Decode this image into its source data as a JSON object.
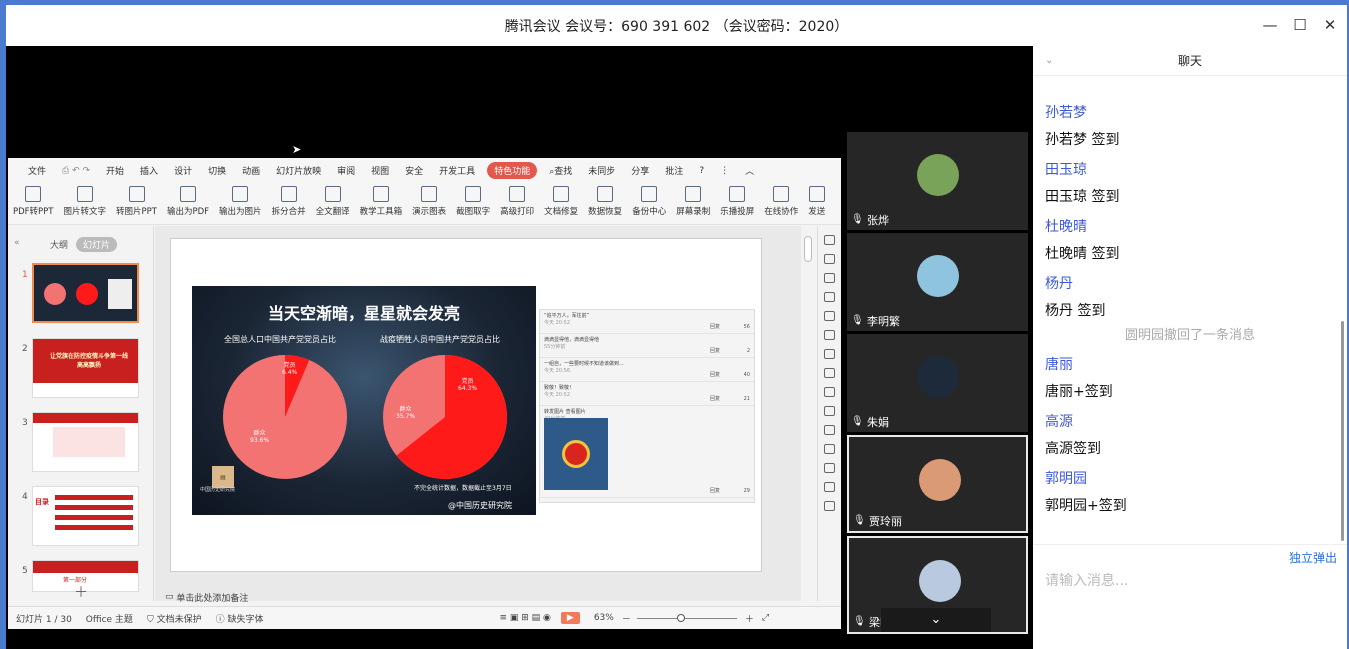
{
  "window": {
    "title": "腾讯会议 会议号：690 391 602 （会议密码：2020）"
  },
  "ppt": {
    "menu": [
      "文件",
      "开始",
      "插入",
      "设计",
      "切换",
      "动画",
      "幻灯片放映",
      "审阅",
      "视图",
      "安全",
      "开发工具"
    ],
    "menu_special": "特色功能",
    "search": "查找",
    "menu_right": [
      "未同步",
      "分享",
      "批注"
    ],
    "toolbar": [
      "PDF转PPT",
      "图片转文字",
      "转图片PPT",
      "输出为PDF",
      "输出为图片",
      "拆分合并",
      "全文翻译",
      "教学工具箱",
      "演示图表",
      "截图取字",
      "高级打印",
      "文档修复",
      "数据恢复",
      "备份中心",
      "屏幕录制",
      "乐播投屏",
      "在线协作",
      "发送"
    ],
    "panel_tabs": [
      "大纲",
      "幻灯片"
    ],
    "slides": [
      "1",
      "2",
      "3",
      "4",
      "5"
    ],
    "slide_texts": {
      "s2": "让党旗在防控疫情斗争第一线高高飘扬",
      "s5": "第一部分",
      "s4": "目录"
    },
    "main_slide": {
      "title": "当天空渐暗，星星就会发亮",
      "left_chart_label": "全国总人口中国共产党党员占比",
      "right_chart_label": "战疫牺牲人员中国共产党党员占比",
      "left_party": "党员",
      "left_party_pct": "6.4%",
      "left_mass": "群众",
      "left_mass_pct": "93.6%",
      "right_party": "党员",
      "right_party_pct": "64.3%",
      "right_mass": "群众",
      "right_mass_pct": "35.7%",
      "footnote": "不完全统计数据，数据截止至3月7日",
      "source": "@中国历史研究院",
      "logo_text": "中国历史研究院"
    },
    "chat_rows": [
      {
        "text": "“追平万人，军往前”",
        "time": "今天 20:52",
        "reply": "回复",
        "likes": "56"
      },
      {
        "text": "滴滴显得他，滴滴显得他",
        "sub": "55分钟前",
        "time": "",
        "reply": "回复",
        "likes": "2"
      },
      {
        "text": "一组自，一些要时候不知道该做到...",
        "time": "今天 20:56",
        "reply": "回复",
        "likes": "40"
      },
      {
        "text": "致敬！致敬！",
        "time": "今天 20:52",
        "reply": "回复",
        "likes": "21"
      },
      {
        "text": "转发图片 查看图片",
        "sub": "40分钟前",
        "time": "",
        "reply": "回复",
        "likes": "29"
      }
    ],
    "notes_placeholder": "单击此处添加备注",
    "status": {
      "slide": "幻灯片 1 / 30",
      "theme": "Office 主题",
      "protect": "文档未保护",
      "font": "缺失字体",
      "zoom": "63%"
    }
  },
  "videos": [
    {
      "name": "张烨",
      "avatar_color": "#7aa35a"
    },
    {
      "name": "李明繁",
      "avatar_color": "#8fc4de"
    },
    {
      "name": "朱娟",
      "avatar_color": "#1c2a3a"
    },
    {
      "name": "贾玲丽",
      "avatar_color": "#d99a75"
    },
    {
      "name": "梁明明",
      "avatar_color": "#b8c9e0"
    }
  ],
  "chat": {
    "title": "聊天",
    "messages": [
      {
        "name": "孙若梦",
        "text": "孙若梦 签到"
      },
      {
        "name": "田玉琼",
        "text": "田玉琼 签到"
      },
      {
        "name": "杜晚晴",
        "text": "杜晚晴 签到"
      },
      {
        "name": "杨丹",
        "text": "杨丹  签到"
      }
    ],
    "system": "圆明园撤回了一条消息",
    "messages2": [
      {
        "name": "唐丽",
        "text": "唐丽+签到"
      },
      {
        "name": "高源",
        "text": "高源签到"
      },
      {
        "name": "郭明园",
        "text": "郭明园+签到"
      }
    ],
    "popout": "独立弹出",
    "input_placeholder": "请输入消息..."
  },
  "colors": {
    "pie_red": "#ff1a1a",
    "pie_pink": "#f37373",
    "accent": "#e2584c",
    "chat_name": "#3f5ad8"
  }
}
